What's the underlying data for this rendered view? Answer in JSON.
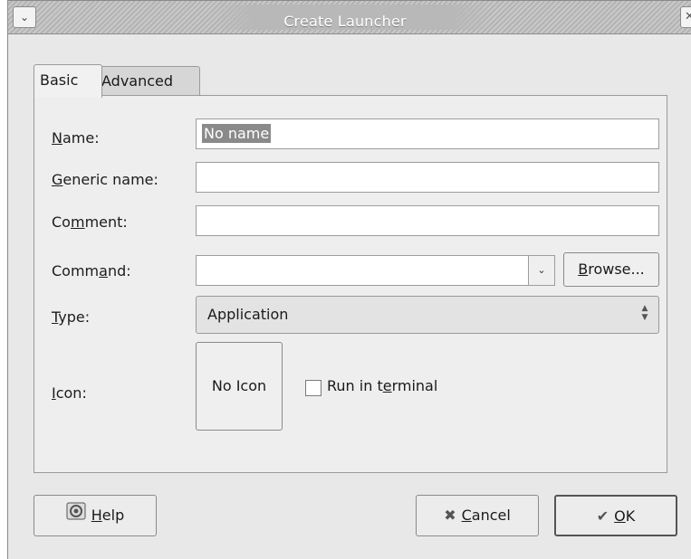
{
  "window": {
    "title": "Create Launcher",
    "menu_icon": "chevron-down-icon",
    "close_icon": "close-icon"
  },
  "tabs": [
    {
      "label": "Basic",
      "active": true
    },
    {
      "label": "Advanced",
      "active": false
    }
  ],
  "form": {
    "name": {
      "label_u": "N",
      "label_rest": "ame:",
      "value": "No name"
    },
    "generic_name": {
      "label_u": "G",
      "label_rest": "eneric name:",
      "value": ""
    },
    "comment": {
      "label_pre": "Co",
      "label_u": "m",
      "label_rest": "ment:",
      "value": ""
    },
    "command": {
      "label_pre": "Comm",
      "label_u": "a",
      "label_rest": "nd:",
      "value": "",
      "browse_u": "B",
      "browse_rest": "rowse..."
    },
    "type": {
      "label_u": "T",
      "label_rest": "ype:",
      "selected": "Application"
    },
    "icon": {
      "label_u": "I",
      "label_rest": "con:",
      "button_label": "No Icon"
    },
    "run_in_terminal": {
      "label_pre": "Run in t",
      "label_u": "e",
      "label_rest": "rminal",
      "checked": false
    }
  },
  "buttons": {
    "help": {
      "label_u": "H",
      "label_rest": "elp",
      "icon": "help-icon"
    },
    "cancel": {
      "label_u": "C",
      "label_rest": "ancel",
      "icon": "cancel-icon"
    },
    "ok": {
      "label_u": "O",
      "label_rest": "K",
      "icon": "check-icon"
    }
  }
}
